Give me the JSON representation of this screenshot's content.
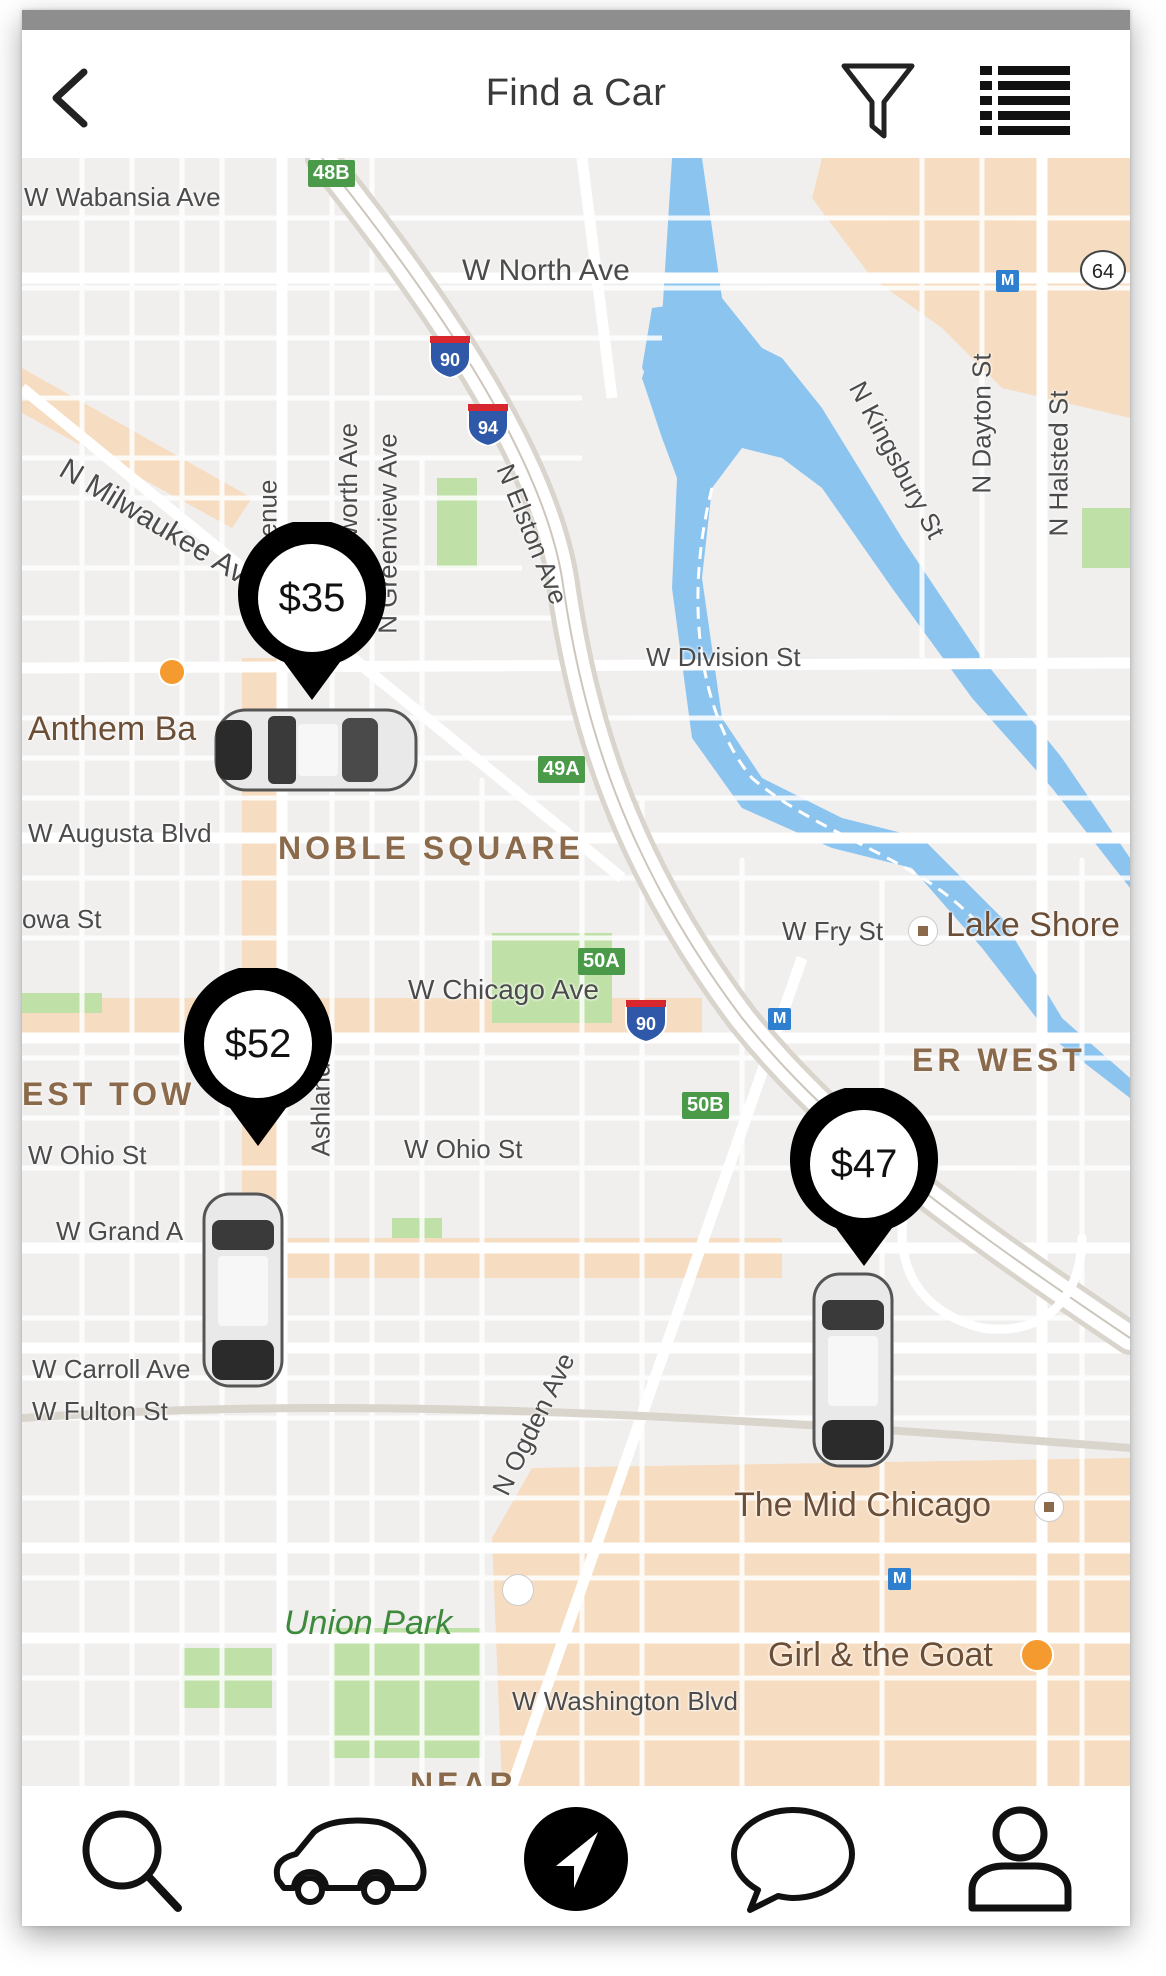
{
  "header": {
    "title": "Find a Car"
  },
  "map": {
    "streets": {
      "wabansia": "W Wabansia Ave",
      "north": "W North Ave",
      "milwaukee": "N Milwaukee Ave",
      "avenue": "d Avenue",
      "bosworth": "osworth Ave",
      "greenview": "N Greenview Ave",
      "elston": "N Elston Ave",
      "kingsbury": "N Kingsbury St",
      "dayton": "N Dayton St",
      "halsted": "N Halsted St",
      "division": "W Division St",
      "augusta": "W Augusta Blvd",
      "iowa": "owa St",
      "fry": "W Fry St",
      "chicago": "W Chicago Ave",
      "ashland": "Ashland",
      "ohio_w": "W Ohio St",
      "ohio_e": "W Ohio St",
      "grand": "W Grand A",
      "ogden": "N Ogden Ave",
      "carroll": "W Carroll Ave",
      "fulton": "W Fulton St",
      "washington": "W Washington Blvd"
    },
    "neighborhoods": {
      "noble": "NOBLE SQUARE",
      "westtown": "EST TOW",
      "riverwest": "ER WEST",
      "near": "NEAR"
    },
    "pois": {
      "anthem": "Anthem Ba",
      "lakeshore": "Lake Shore",
      "midchicago": "The Mid Chicago",
      "girlgoat": "Girl & the Goat"
    },
    "park": "Union Park",
    "highway_shields": {
      "s48b": "48B",
      "s49a": "49A",
      "s50a": "50A",
      "s50b": "50B",
      "i90a": "90",
      "i94": "94",
      "i90b": "90",
      "r64": "64"
    },
    "metro_label": "M"
  },
  "listings": [
    {
      "price": "$35"
    },
    {
      "price": "$52"
    },
    {
      "price": "$47"
    }
  ],
  "tabs": [
    "search-icon",
    "car-icon",
    "navigation-icon",
    "chat-icon",
    "profile-icon"
  ],
  "colors": {
    "map_bg": "#f1efee",
    "water": "#8cc4f0",
    "park": "#bfe0a6",
    "commercial": "#f6dcc0",
    "pin": "#000000"
  }
}
